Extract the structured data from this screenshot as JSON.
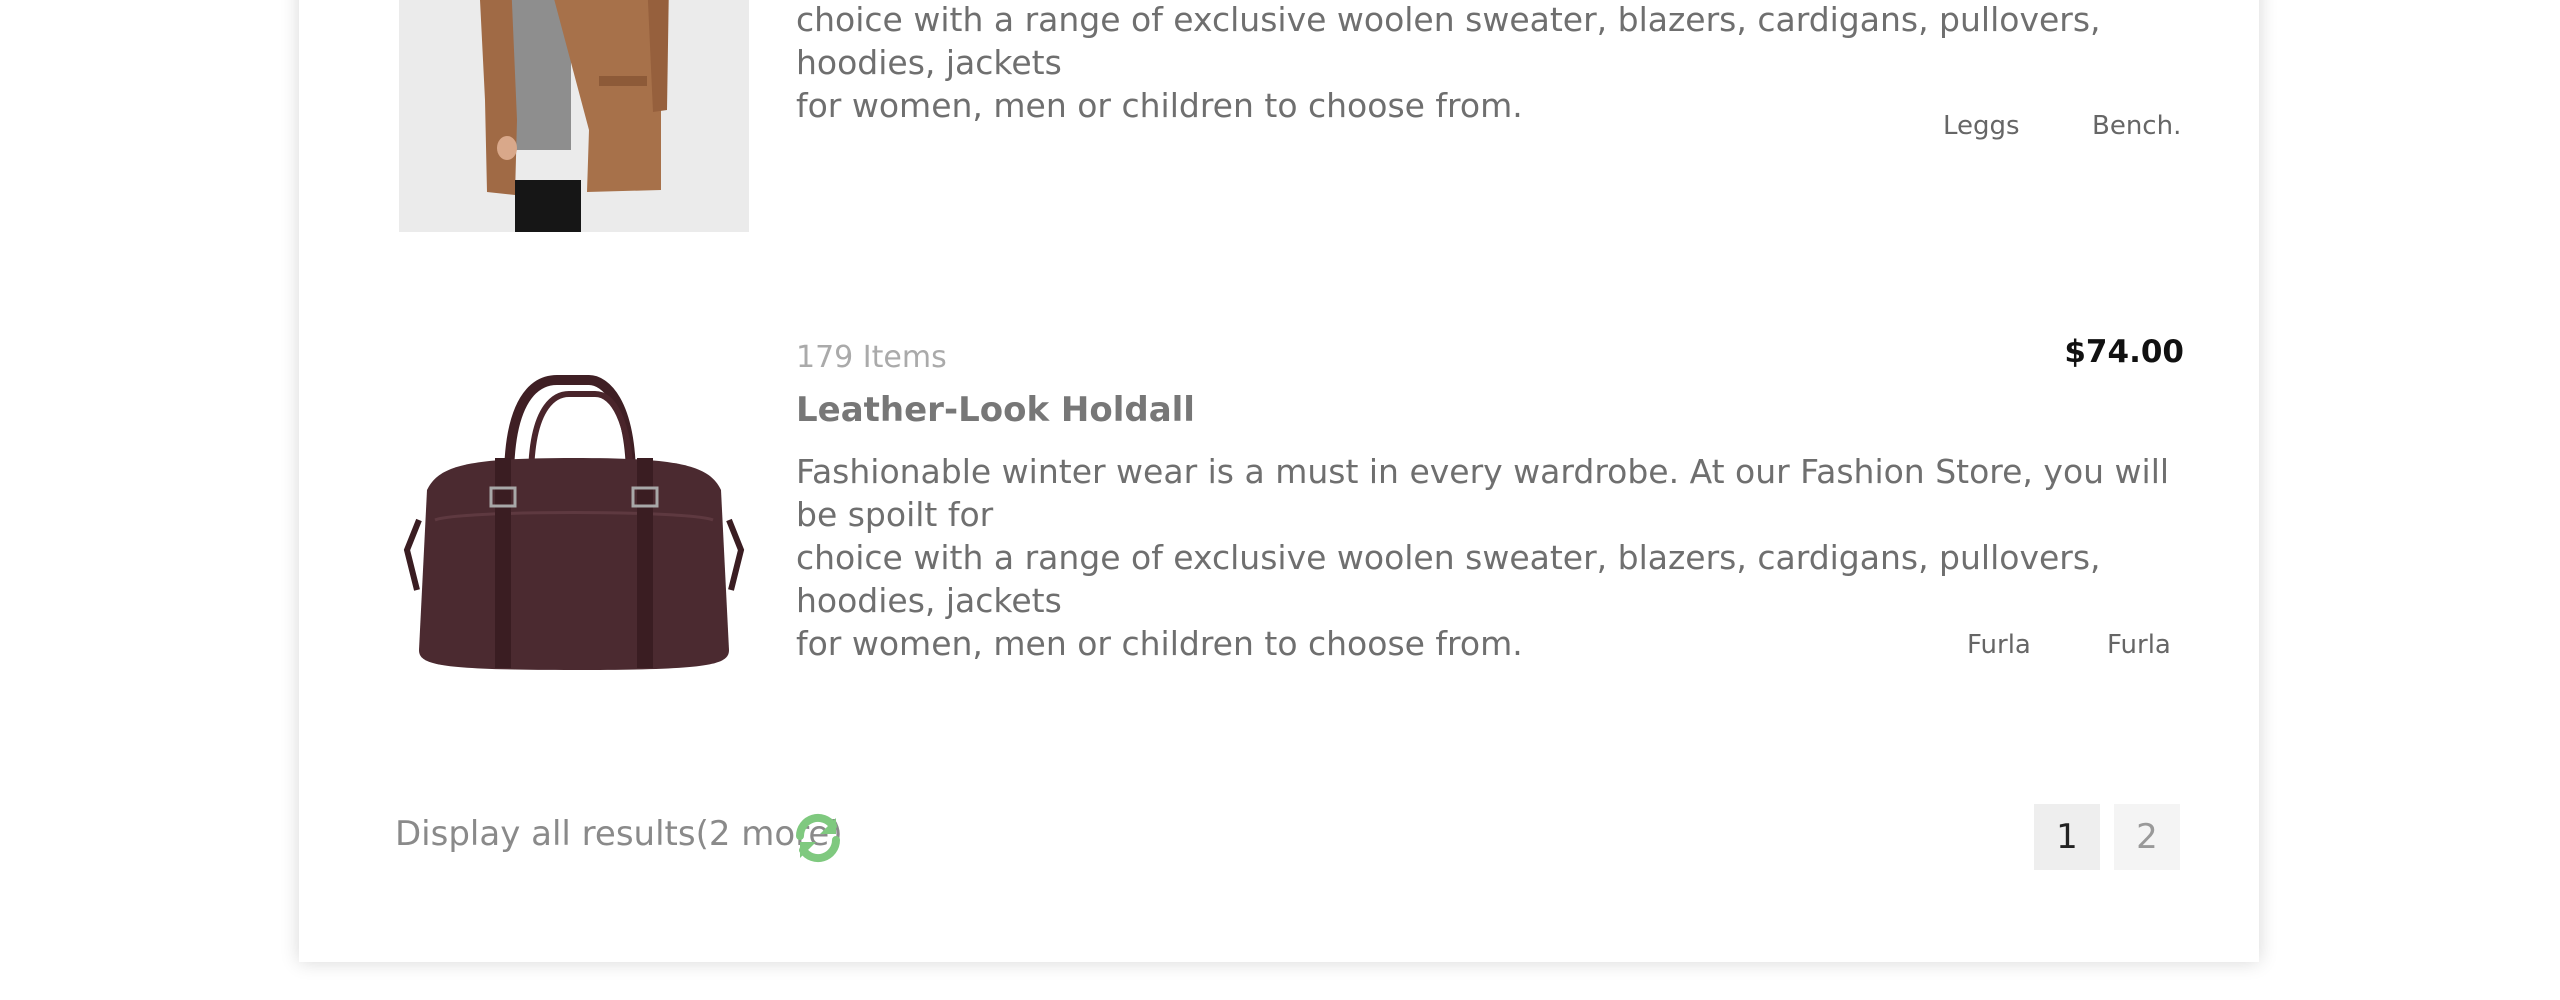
{
  "colors": {
    "panel_bg": "#ffffff",
    "accent_green": "#7fc97f",
    "text_gray": "#6f6f6f",
    "price_black": "#111111"
  },
  "products": [
    {
      "description_line1": "choice with a range of exclusive woolen sweater, blazers, cardigans, pullovers, hoodies, jackets",
      "description_line2": "for women, men or children to choose from.",
      "brands": [
        "Leggs",
        "Bench."
      ],
      "image_icon": "coat-image"
    },
    {
      "items_count": "179 Items",
      "title": "Leather-Look Holdall",
      "price": "$74.00",
      "description_line1": "Fashionable winter wear is a must in every wardrobe. At our Fashion Store, you will be spoilt for",
      "description_line2": "choice with a range of exclusive woolen sweater, blazers, cardigans, pullovers, hoodies, jackets",
      "description_line3": "for women, men or children to choose from.",
      "brands": [
        "Furla",
        "Furla"
      ],
      "image_icon": "holdall-bag-image"
    }
  ],
  "footer": {
    "display_all_label": "Display all results(2 more)",
    "refresh_icon": "refresh-icon",
    "pages": [
      "1",
      "2"
    ],
    "current_page": "1"
  }
}
